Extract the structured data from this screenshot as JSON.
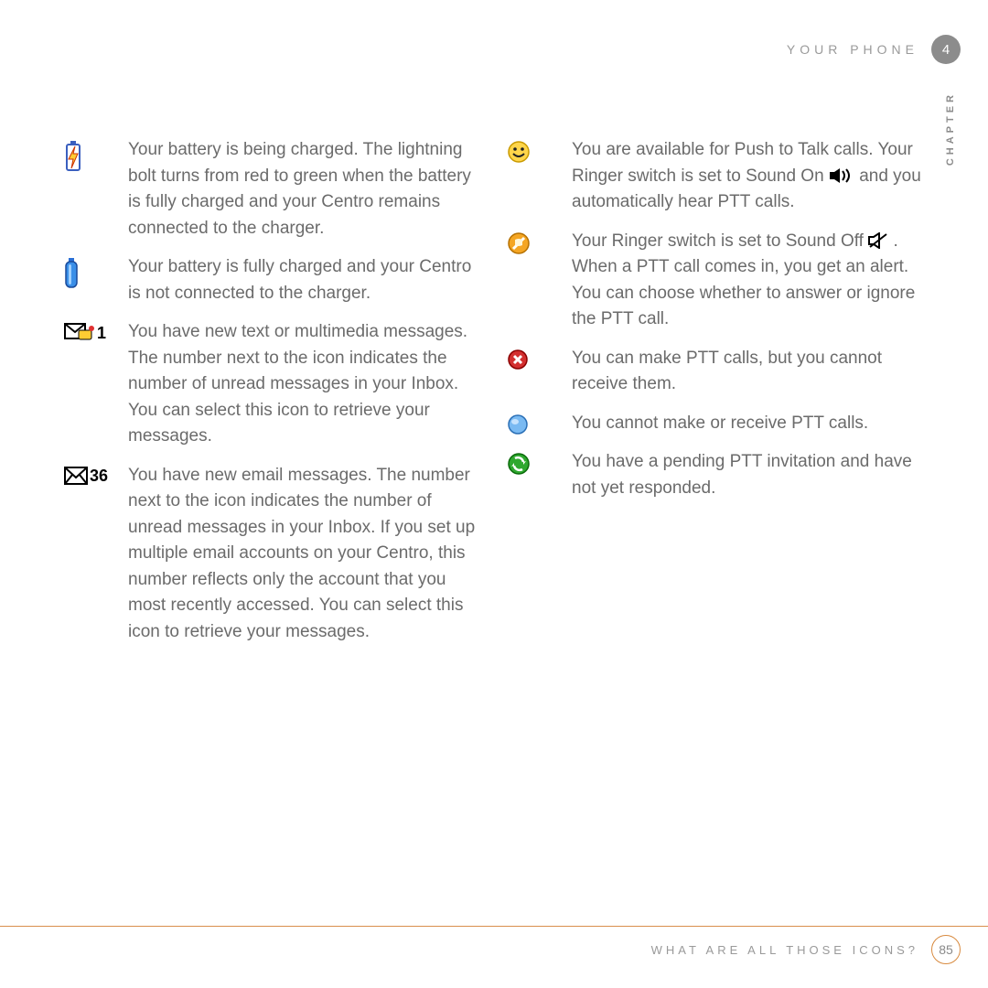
{
  "header": {
    "section_title": "YOUR PHONE",
    "chapter_number": "4",
    "chapter_label": "CHAPTER"
  },
  "footer": {
    "subsection": "WHAT ARE ALL THOSE ICONS?",
    "page_number": "85"
  },
  "left_col": [
    {
      "icon": "battery-charging-icon",
      "text": "Your battery is being charged. The lightning bolt turns from red to green when the battery is fully charged and your Centro remains connected to the charger."
    },
    {
      "icon": "battery-full-icon",
      "text": "Your battery is fully charged and your Centro is not connected to the charger."
    },
    {
      "icon": "new-message-icon",
      "icon_label": "1",
      "text": "You have new text or multimedia messages. The number next to the icon indicates the number of unread messages in your Inbox. You can select this icon to retrieve your messages."
    },
    {
      "icon": "new-email-icon",
      "icon_label": "36",
      "text": "You have new email messages. The number next to the icon indicates the number of unread messages in your Inbox. If you set up multiple email accounts on your Centro, this number reflects only the account that you most recently accessed. You can select this icon to retrieve your messages."
    }
  ],
  "right_col": [
    {
      "icon": "ptt-available-icon",
      "text_parts": [
        "You are available for Push to Talk calls. Your Ringer switch is set to Sound On ",
        " and you automatically hear PTT calls."
      ],
      "inline_icon": "sound-on-icon"
    },
    {
      "icon": "ptt-silent-icon",
      "text_parts": [
        "Your Ringer switch is set to Sound Off ",
        ". When a PTT call comes in, you get an alert. You can choose whether to answer or ignore the PTT call."
      ],
      "inline_icon": "sound-off-icon"
    },
    {
      "icon": "ptt-dnd-icon",
      "text": "You can make PTT calls, but you cannot receive them."
    },
    {
      "icon": "ptt-unavailable-icon",
      "text": "You cannot make or receive PTT calls."
    },
    {
      "icon": "ptt-invitation-icon",
      "text": "You have a pending PTT invitation and have not yet responded."
    }
  ]
}
